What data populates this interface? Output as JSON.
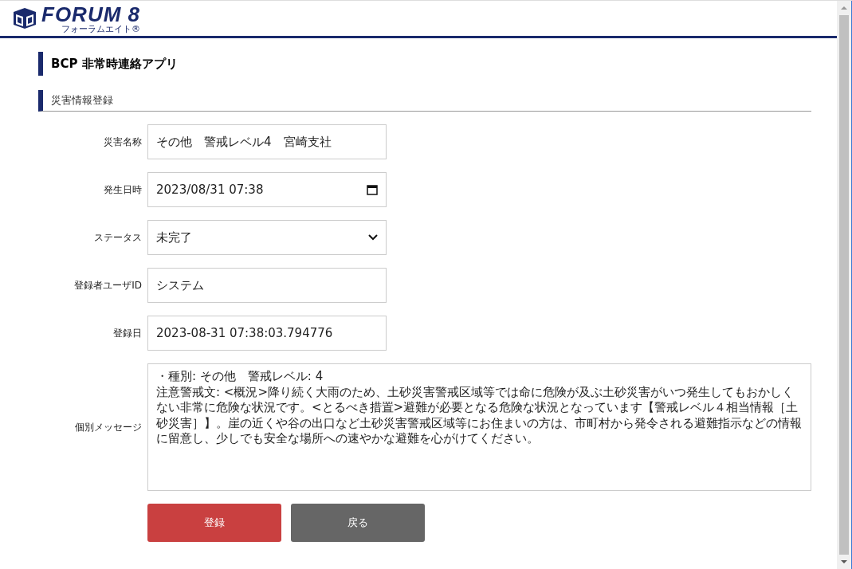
{
  "header": {
    "logo_text": "FORUM 8",
    "logo_subtext": "フォーラムエイト®"
  },
  "page_title": "BCP 非常時連絡アプリ",
  "section_title": "災害情報登録",
  "fields": [
    {
      "kind": "text",
      "label": "災害名称",
      "value": "その他　警戒レベル4　宮崎支社"
    },
    {
      "kind": "datetime",
      "label": "発生日時",
      "value": "2023/08/31 07:38"
    },
    {
      "kind": "select",
      "label": "ステータス",
      "value": "未完了"
    },
    {
      "kind": "text",
      "label": "登録者ユーザID",
      "value": "システム"
    },
    {
      "kind": "text",
      "label": "登録日",
      "value": "2023-08-31 07:38:03.794776"
    },
    {
      "kind": "textarea",
      "label": "個別メッセージ",
      "value": "・種別: その他　警戒レベル: 4\n注意警戒文: <概況>降り続く大雨のため、土砂災害警戒区域等では命に危険が及ぶ土砂災害がいつ発生してもおかしくない非常に危険な状況です。<とるべき措置>避難が必要となる危険な状況となっています【警戒レベル４相当情報［土砂災害］】。崖の近くや谷の出口など土砂災害警戒区域等にお住まいの方は、市町村から発令される避難指示などの情報に留意し、少しでも安全な場所への速やかな避難を心がけてください。"
    }
  ],
  "buttons": [
    {
      "kind": "primary",
      "label": "登録"
    },
    {
      "kind": "secondary",
      "label": "戻る"
    }
  ]
}
